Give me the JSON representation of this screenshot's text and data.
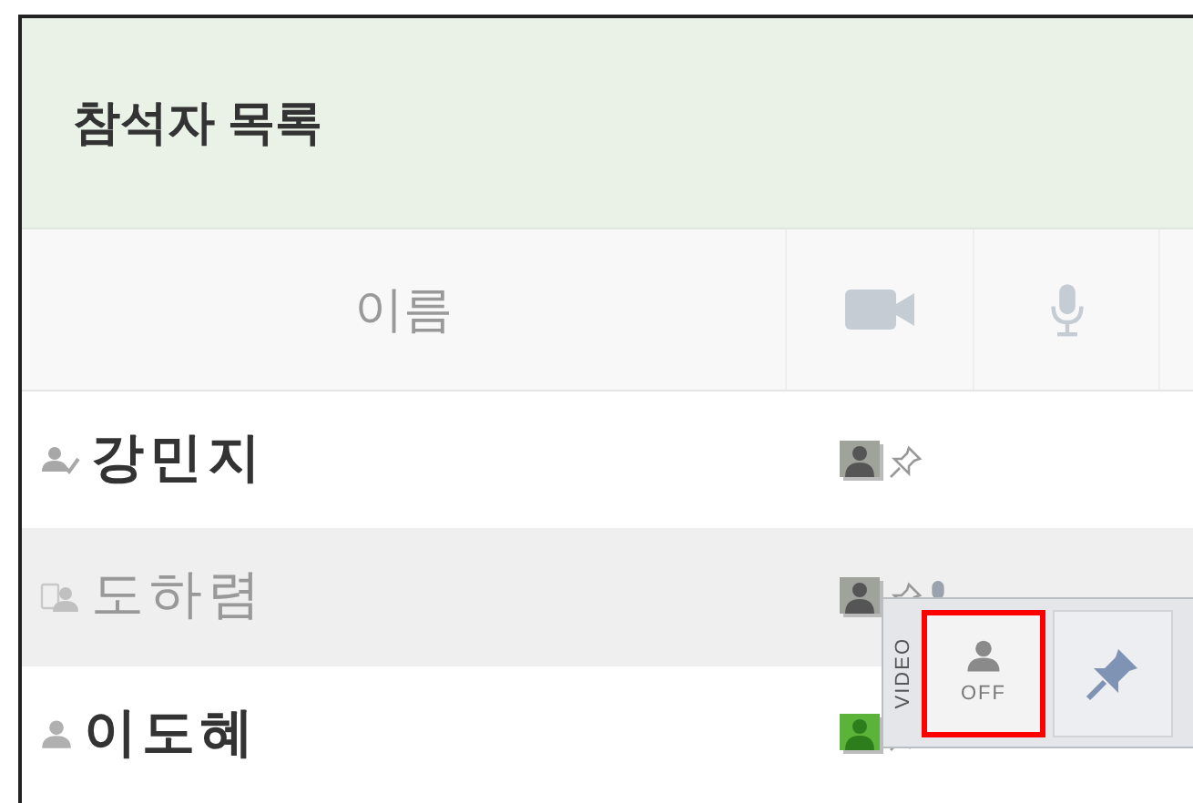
{
  "panel": {
    "title": "참석자 목록"
  },
  "columns": [
    {
      "kind": "name",
      "label": "이름"
    },
    {
      "kind": "video"
    },
    {
      "kind": "mic"
    },
    {
      "kind": "blank"
    }
  ],
  "rows": [
    {
      "name": "강민지",
      "kind": "presenter",
      "dimmed": false,
      "selected": false,
      "video_on": false,
      "mic": false
    },
    {
      "name": "도하렴",
      "kind": "away",
      "dimmed": true,
      "selected": true,
      "video_on": false,
      "mic": true
    },
    {
      "name": "이도혜",
      "kind": "member",
      "dimmed": false,
      "selected": false,
      "video_on": true,
      "mic": false
    }
  ],
  "video_popup": {
    "label": "VIDEO",
    "off_button": {
      "text": "OFF",
      "highlighted": true
    }
  }
}
